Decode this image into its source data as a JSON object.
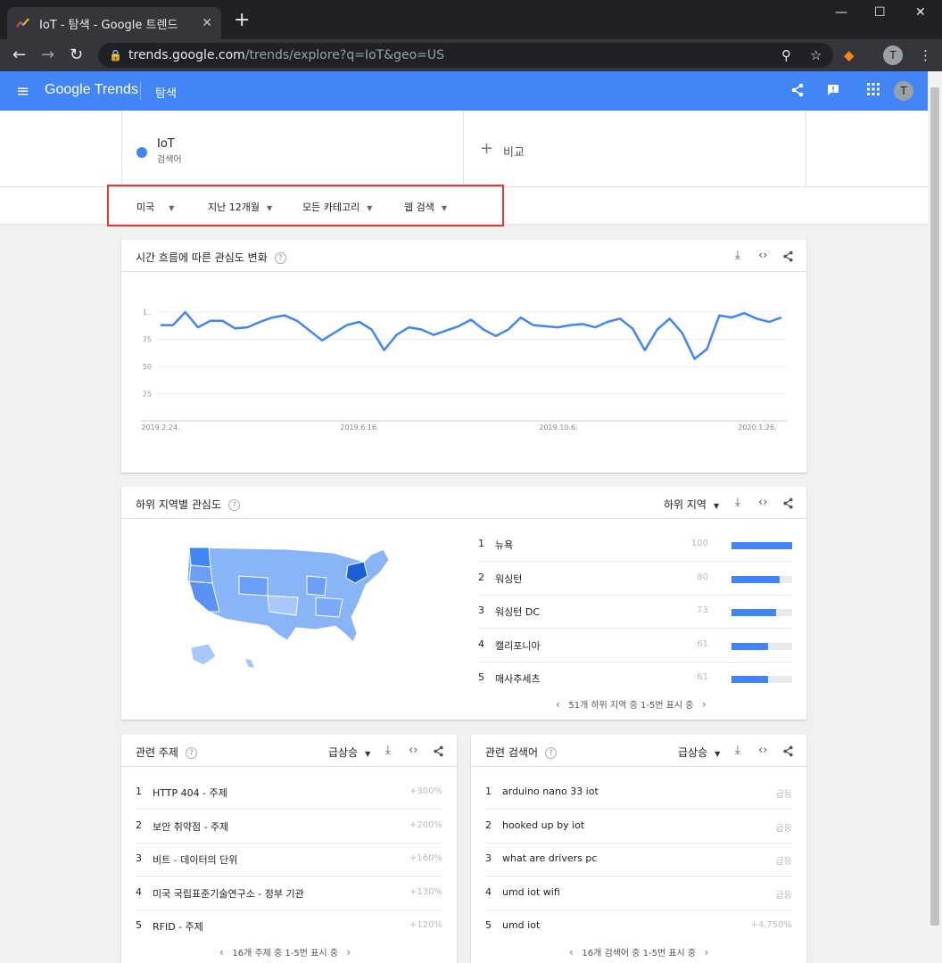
{
  "browser": {
    "tab_title": "IoT - 탐색 - Google 트렌드",
    "url_host": "trends.google.com",
    "url_path": "/trends/explore?q=IoT&geo=US",
    "profile_initial": "T"
  },
  "header": {
    "logo": "Google Trends",
    "section": "탐색",
    "profile_initial": "T"
  },
  "search_term": {
    "name": "IoT",
    "type": "검색어",
    "color": "#4285f4"
  },
  "compare_label": "비교",
  "filters": {
    "region": "미국",
    "period": "지난 12개월",
    "category": "모든 카테고리",
    "search_type": "웹 검색"
  },
  "interest_over_time": {
    "title": "시간 흐름에 따른 관심도 변화",
    "chart_data": {
      "type": "line",
      "title": "",
      "ylim": [
        0,
        100
      ],
      "y_tick_labels": [
        "1..",
        "75",
        "50",
        "25"
      ],
      "x_tick_labels": [
        "2019.2.24.",
        "2019.6.16.",
        "2019.10.6.",
        "2020.1.26."
      ],
      "grid": true,
      "series": [
        {
          "color": "#4285f4",
          "values": [
            88,
            88,
            100,
            86,
            92,
            92,
            85,
            86,
            91,
            95,
            97,
            92,
            83,
            74,
            81,
            88,
            91,
            84,
            65,
            79,
            86,
            84,
            79,
            83,
            87,
            93,
            84,
            78,
            84,
            95,
            88,
            87,
            86,
            88,
            89,
            86,
            91,
            94,
            85,
            65,
            84,
            94,
            81,
            57,
            66,
            97,
            95,
            99,
            94,
            91,
            95
          ]
        }
      ]
    }
  },
  "regional": {
    "title": "하위 지역별 관심도",
    "dropdown": "하위 지역",
    "rows": [
      {
        "rank": "1",
        "name": "뉴욕",
        "value": "100",
        "score": 100
      },
      {
        "rank": "2",
        "name": "워싱턴",
        "value": "80",
        "score": 80
      },
      {
        "rank": "3",
        "name": "워싱턴 DC",
        "value": "73",
        "score": 73
      },
      {
        "rank": "4",
        "name": "캘리포니아",
        "value": "61",
        "score": 61
      },
      {
        "rank": "5",
        "name": "매사추세츠",
        "value": "61",
        "score": 61
      }
    ],
    "pager": "51개 하위 지역 중 1-5번 표시 중"
  },
  "related_topics": {
    "title": "관련 주제",
    "dropdown": "급상승",
    "rows": [
      {
        "rank": "1",
        "name": "HTTP 404 - 주제",
        "value": "+300%"
      },
      {
        "rank": "2",
        "name": "보안 취약점 - 주제",
        "value": "+200%"
      },
      {
        "rank": "3",
        "name": "비트 - 데이터의 단위",
        "value": "+160%"
      },
      {
        "rank": "4",
        "name": "미국 국립표준기술연구소 - 정부 기관",
        "value": "+130%"
      },
      {
        "rank": "5",
        "name": "RFID - 주제",
        "value": "+120%"
      }
    ],
    "pager": "16개 주제 중 1-5번 표시 중"
  },
  "related_queries": {
    "title": "관련 검색어",
    "dropdown": "급상승",
    "rows": [
      {
        "rank": "1",
        "name": "arduino nano 33 iot",
        "value": "급등"
      },
      {
        "rank": "2",
        "name": "hooked up by iot",
        "value": "급등"
      },
      {
        "rank": "3",
        "name": "what are drivers pc",
        "value": "급등"
      },
      {
        "rank": "4",
        "name": "umd iot wifi",
        "value": "급등"
      },
      {
        "rank": "5",
        "name": "umd iot",
        "value": "+4,750%"
      }
    ],
    "pager": "16개 검색어 중 1-5번 표시 중"
  },
  "icons": {
    "menu": "menu-icon",
    "share": "share-icon",
    "feedback": "feedback-icon",
    "apps": "apps-icon",
    "download": "download-icon",
    "embed": "embed-icon",
    "help": "help-icon"
  }
}
